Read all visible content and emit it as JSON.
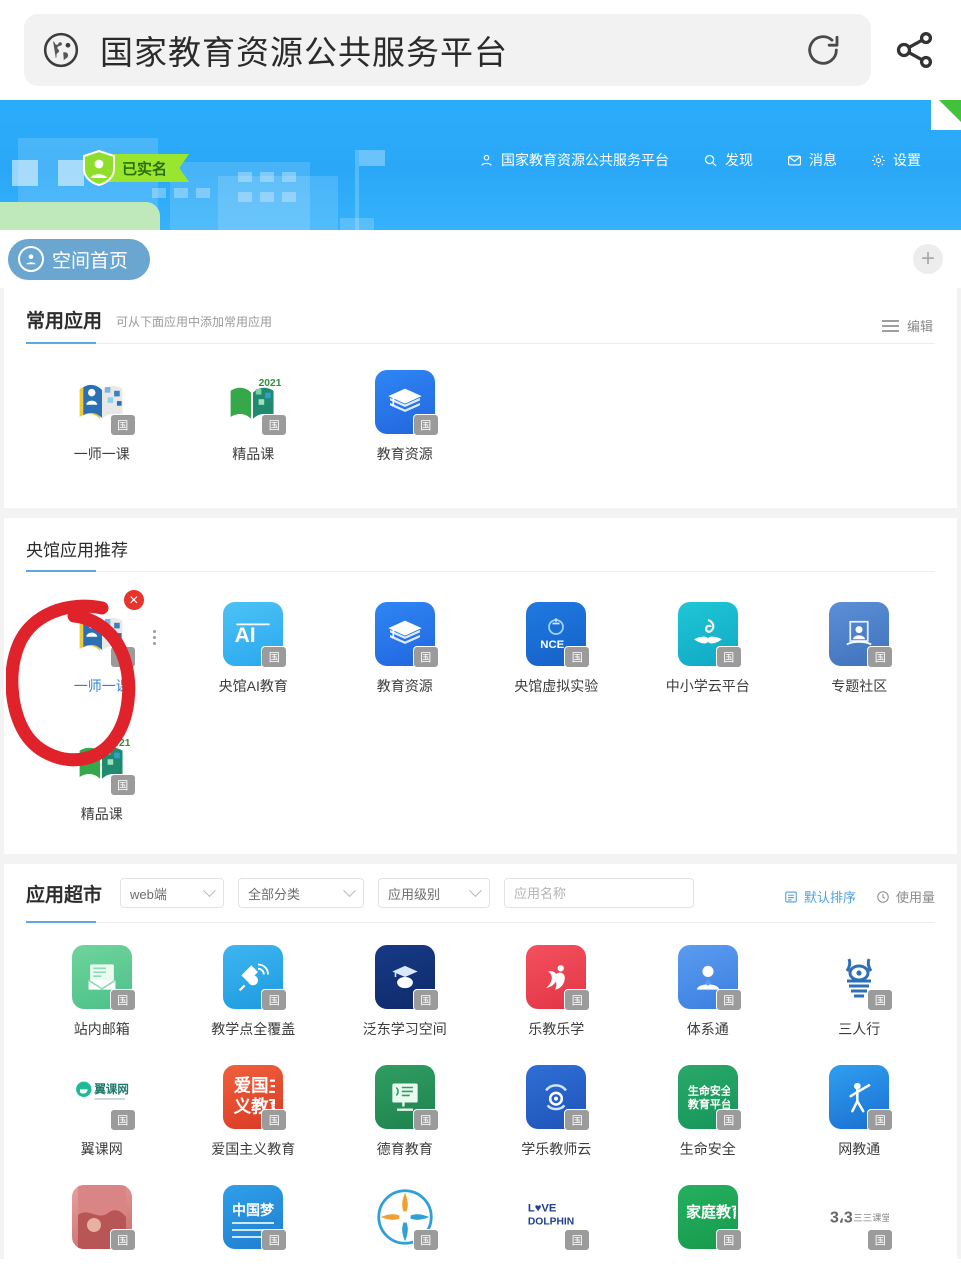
{
  "browser": {
    "site_icon": "globe-icon",
    "page_title": "国家教育资源公共服务平台",
    "reload_icon": "reload-icon",
    "share_icon": "share-icon"
  },
  "banner": {
    "verified_badge": "已实名",
    "nav": [
      {
        "icon": "user-icon",
        "label": "国家教育资源公共服务平台"
      },
      {
        "icon": "search-icon",
        "label": "发现"
      },
      {
        "icon": "message-icon",
        "label": "消息"
      },
      {
        "icon": "gear-icon",
        "label": "设置"
      }
    ]
  },
  "tabs": {
    "active_tab": "空间首页",
    "add_tab_label": "+"
  },
  "common_apps": {
    "title": "常用应用",
    "subtitle": "可从下面应用中添加常用应用",
    "edit_label": "编辑",
    "apps": [
      {
        "label": "一师一课",
        "badge": "国"
      },
      {
        "label": "精品课",
        "badge": "国"
      },
      {
        "label": "教育资源",
        "badge": "国"
      }
    ]
  },
  "recommended": {
    "title": "央馆应用推荐",
    "apps": [
      {
        "label": "一师一课",
        "badge": "国",
        "selected": true,
        "delete_badge": "×"
      },
      {
        "label": "央馆AI教育",
        "badge": "国"
      },
      {
        "label": "教育资源",
        "badge": "国"
      },
      {
        "label": "央馆虚拟实验",
        "badge": "国"
      },
      {
        "label": "中小学云平台",
        "badge": "国"
      },
      {
        "label": "专题社区",
        "badge": "国"
      },
      {
        "label": "精品课",
        "badge": "国"
      }
    ]
  },
  "app_market": {
    "title": "应用超市",
    "filters": [
      {
        "name": "platform",
        "value": "web端"
      },
      {
        "name": "category",
        "value": "全部分类"
      },
      {
        "name": "level",
        "value": "应用级别"
      }
    ],
    "search_placeholder": "应用名称",
    "search_value": "",
    "sorts": [
      {
        "label": "默认排序",
        "active": true
      },
      {
        "label": "使用量",
        "active": false
      }
    ],
    "rows": [
      [
        {
          "label": "站内邮箱",
          "badge": "国"
        },
        {
          "label": "教学点全覆盖",
          "badge": "国"
        },
        {
          "label": "泛东学习空间",
          "badge": "国"
        },
        {
          "label": "乐教乐学",
          "badge": "国"
        },
        {
          "label": "体系通",
          "badge": "国"
        },
        {
          "label": "三人行",
          "badge": "国"
        }
      ],
      [
        {
          "label": "翼课网",
          "badge": "国"
        },
        {
          "label": "爱国主义教育",
          "badge": "国"
        },
        {
          "label": "德育教育",
          "badge": "国"
        },
        {
          "label": "学乐教师云",
          "badge": "国"
        },
        {
          "label": "生命安全",
          "badge": "国"
        },
        {
          "label": "网教通",
          "badge": "国"
        }
      ],
      [
        {
          "label": "",
          "badge": "国"
        },
        {
          "label": "",
          "badge": "国"
        },
        {
          "label": "",
          "badge": "国"
        },
        {
          "label": "",
          "badge": "国"
        },
        {
          "label": "",
          "badge": "国"
        },
        {
          "label": "",
          "badge": "国"
        }
      ]
    ]
  },
  "annotation": {
    "type": "hand-drawn-red-circle",
    "color": "#e0222b",
    "target": "一师一课"
  },
  "colors": {
    "banner_blue": "#2bacfa",
    "accent_blue": "#5aa9e6",
    "verified_green": "#9ae52e",
    "delete_red": "#e8342a",
    "annotation_red": "#e0222b"
  }
}
